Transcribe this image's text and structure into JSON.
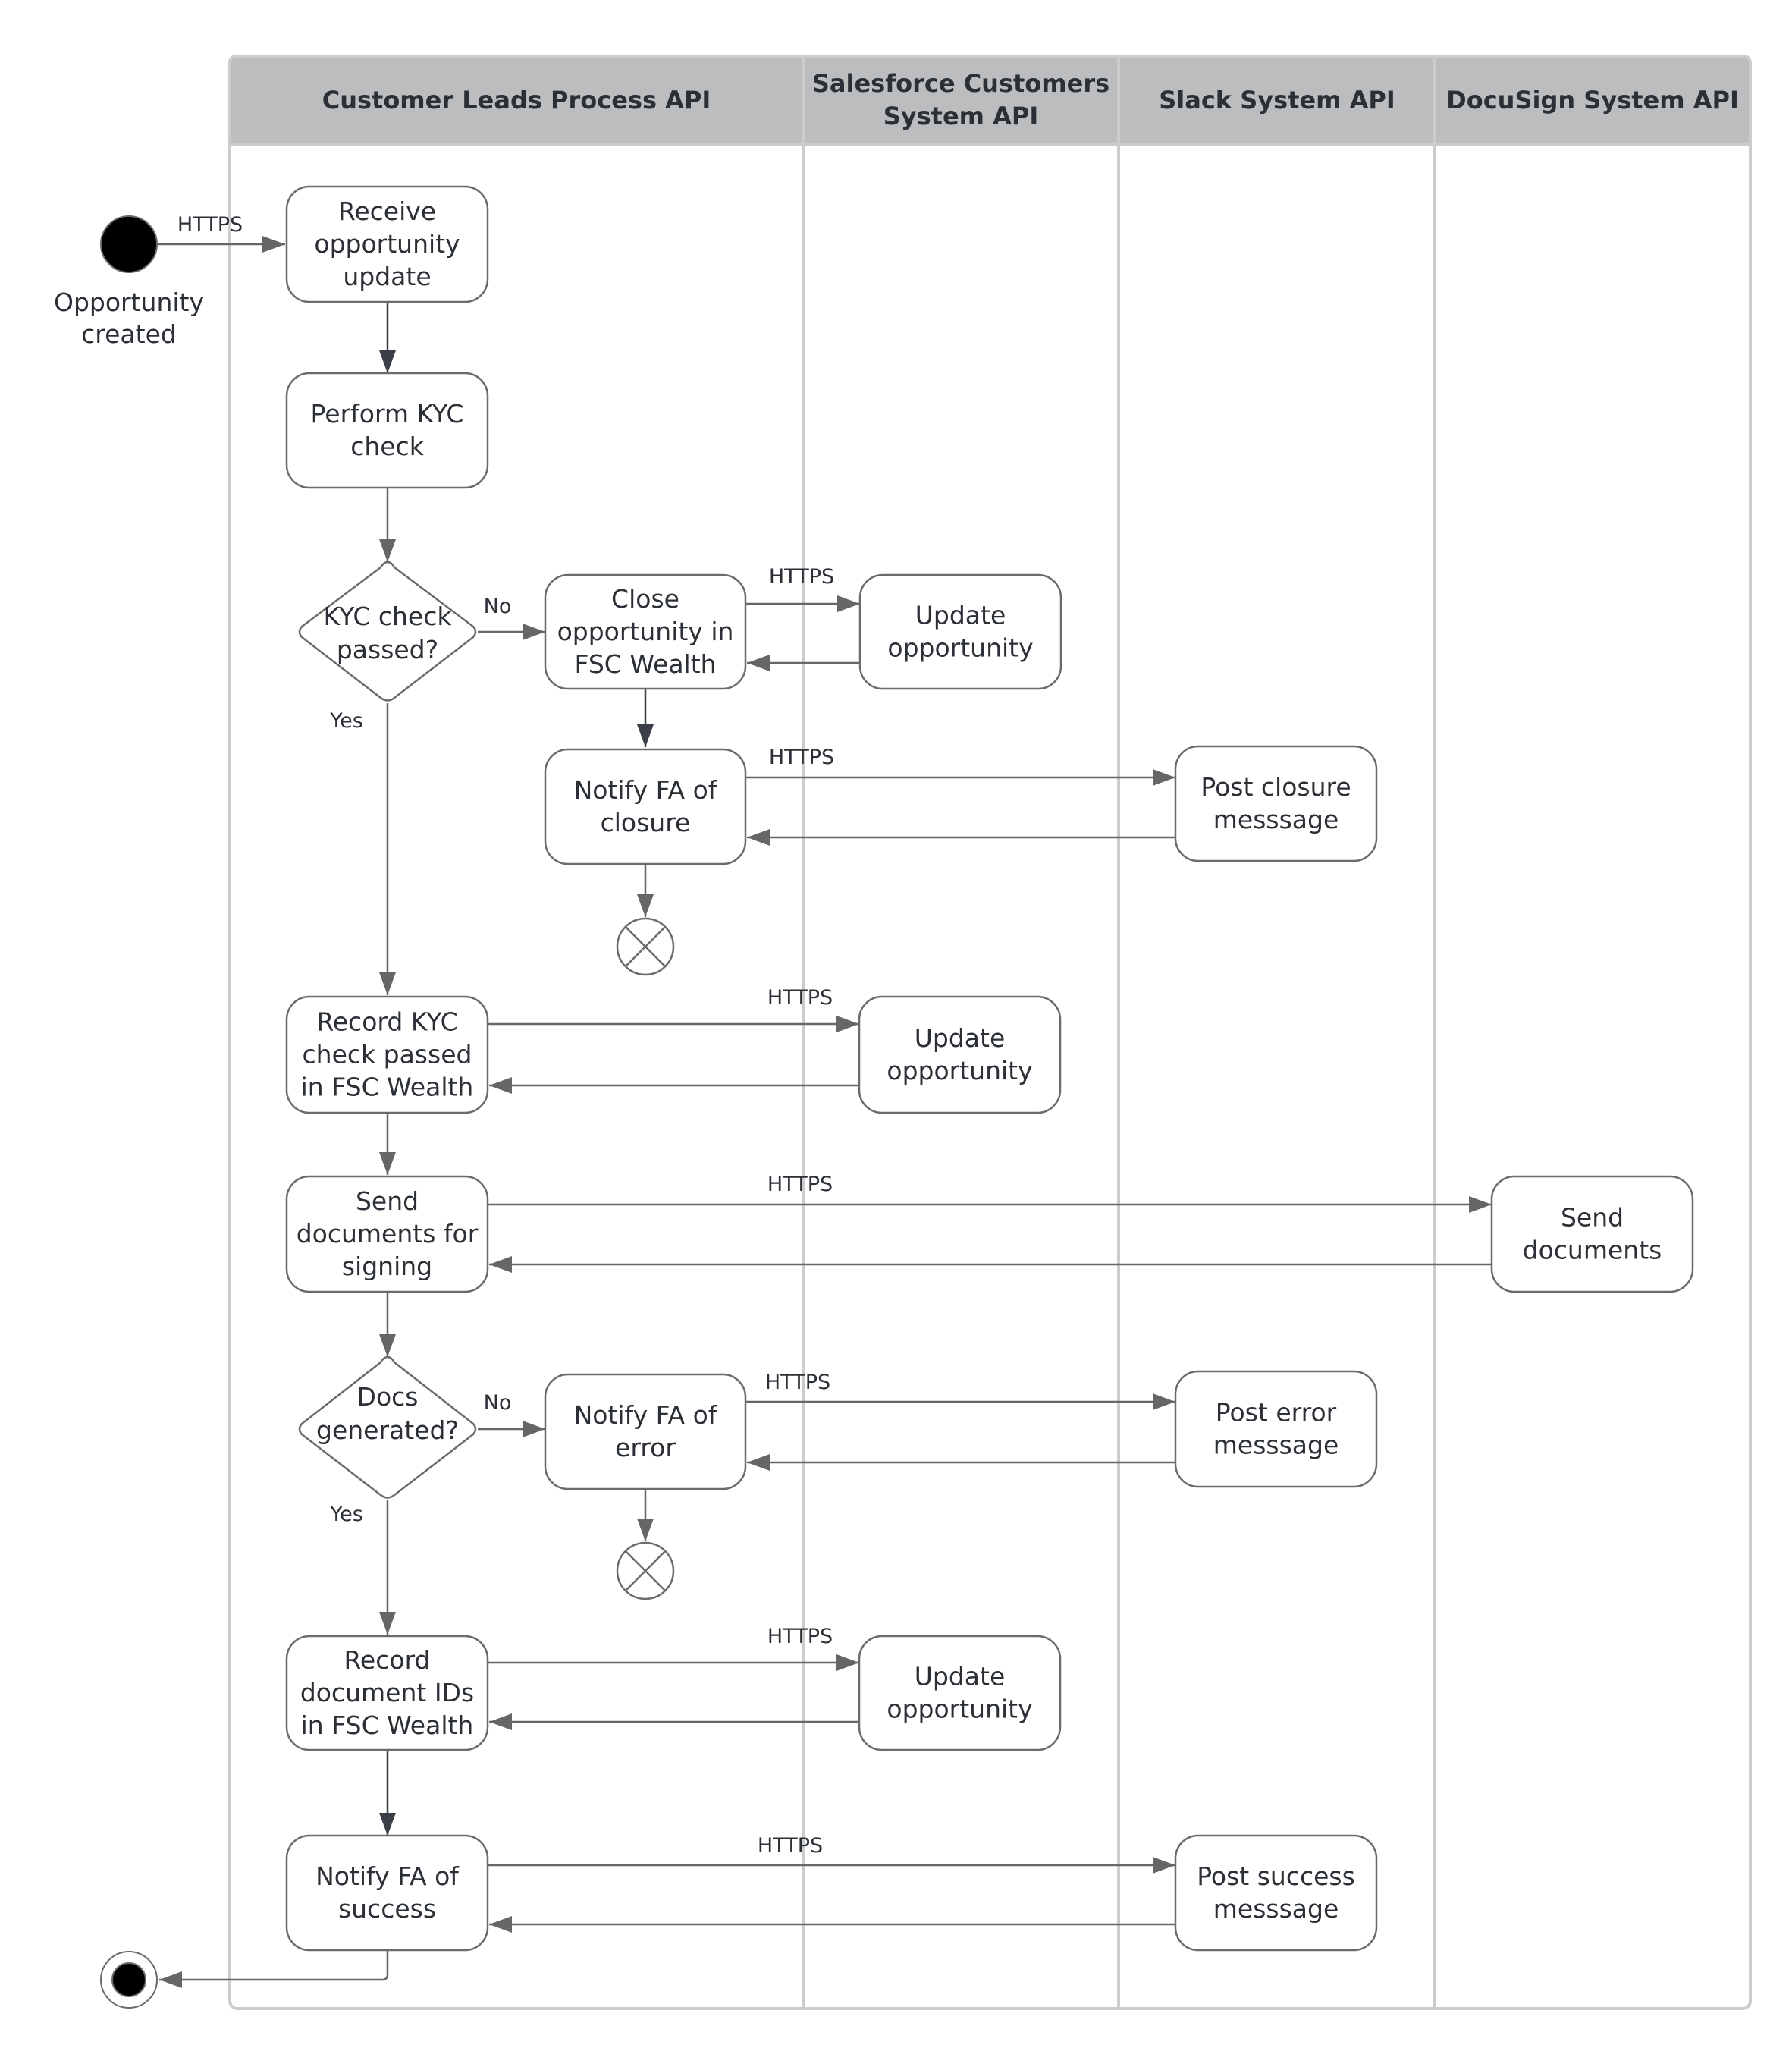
{
  "diagram": {
    "type": "UML activity diagram (swimlanes)",
    "lanes": [
      {
        "id": "lane-process",
        "title": [
          "Customer Leads Process API"
        ]
      },
      {
        "id": "lane-salesforce",
        "title": [
          "Salesforce Customers",
          "System API"
        ]
      },
      {
        "id": "lane-slack",
        "title": [
          "Slack System API"
        ]
      },
      {
        "id": "lane-docusign",
        "title": [
          "DocuSign System API"
        ]
      }
    ],
    "start": {
      "label": [
        "Opportunity",
        "created"
      ]
    },
    "nodes": {
      "receive": [
        "Receive",
        "opportunity",
        "update"
      ],
      "kyc": [
        "Perform KYC",
        "check"
      ],
      "kyc_decision": [
        "KYC check",
        "passed?"
      ],
      "close_opp": [
        "Close",
        "opportunity in",
        "FSC Wealth"
      ],
      "update_opp_1": [
        "Update",
        "opportunity"
      ],
      "notify_closure": [
        "Notify FA of",
        "closure"
      ],
      "post_closure": [
        "Post closure",
        "messsage"
      ],
      "record_kyc": [
        "Record KYC",
        "check passed",
        "in FSC Wealth"
      ],
      "update_opp_2": [
        "Update",
        "opportunity"
      ],
      "send_docs": [
        "Send",
        "documents for",
        "signing"
      ],
      "send_documents": [
        "Send",
        "documents"
      ],
      "docs_decision": [
        "Docs",
        "generated?"
      ],
      "notify_error": [
        "Notify FA of",
        "error"
      ],
      "post_error": [
        "Post error",
        "messsage"
      ],
      "record_docs": [
        "Record",
        "document IDs",
        "in FSC Wealth"
      ],
      "update_opp_3": [
        "Update",
        "opportunity"
      ],
      "notify_success": [
        "Notify FA of",
        "success"
      ],
      "post_success": [
        "Post success",
        "messsage"
      ]
    },
    "edge_labels": {
      "https": "HTTPS",
      "yes": "Yes",
      "no": "No"
    },
    "edges": [
      {
        "from": "start",
        "to": "receive",
        "label": "HTTPS"
      },
      {
        "from": "receive",
        "to": "kyc"
      },
      {
        "from": "kyc",
        "to": "kyc_decision"
      },
      {
        "from": "kyc_decision",
        "to": "close_opp",
        "label": "No"
      },
      {
        "from": "kyc_decision",
        "to": "record_kyc",
        "label": "Yes"
      },
      {
        "from": "close_opp",
        "to": "update_opp_1",
        "label": "HTTPS"
      },
      {
        "from": "update_opp_1",
        "to": "close_opp"
      },
      {
        "from": "close_opp",
        "to": "notify_closure"
      },
      {
        "from": "notify_closure",
        "to": "post_closure",
        "label": "HTTPS"
      },
      {
        "from": "post_closure",
        "to": "notify_closure"
      },
      {
        "from": "notify_closure",
        "to": "flow_final_1"
      },
      {
        "from": "record_kyc",
        "to": "update_opp_2",
        "label": "HTTPS"
      },
      {
        "from": "update_opp_2",
        "to": "record_kyc"
      },
      {
        "from": "record_kyc",
        "to": "send_docs"
      },
      {
        "from": "send_docs",
        "to": "send_documents",
        "label": "HTTPS"
      },
      {
        "from": "send_documents",
        "to": "send_docs"
      },
      {
        "from": "send_docs",
        "to": "docs_decision"
      },
      {
        "from": "docs_decision",
        "to": "notify_error",
        "label": "No"
      },
      {
        "from": "docs_decision",
        "to": "record_docs",
        "label": "Yes"
      },
      {
        "from": "notify_error",
        "to": "post_error",
        "label": "HTTPS"
      },
      {
        "from": "post_error",
        "to": "notify_error"
      },
      {
        "from": "notify_error",
        "to": "flow_final_2"
      },
      {
        "from": "record_docs",
        "to": "update_opp_3",
        "label": "HTTPS"
      },
      {
        "from": "update_opp_3",
        "to": "record_docs"
      },
      {
        "from": "record_docs",
        "to": "notify_success"
      },
      {
        "from": "notify_success",
        "to": "post_success",
        "label": "HTTPS"
      },
      {
        "from": "post_success",
        "to": "notify_success"
      },
      {
        "from": "notify_success",
        "to": "end"
      }
    ]
  },
  "colors": {
    "header_fill": "#bcbdbf",
    "lane_border": "#cccccc",
    "node_stroke": "#6b6b6b",
    "edge": "#666666",
    "edge_dark": "#3a3f47",
    "text": "#2b2f36",
    "start_fill": "#000000"
  }
}
